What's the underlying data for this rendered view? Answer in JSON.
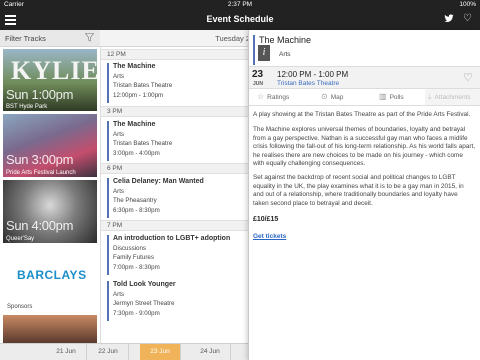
{
  "status": {
    "carrier": "Carrier",
    "time": "2:37 PM",
    "battery": "100%"
  },
  "nav": {
    "title": "Event Schedule"
  },
  "filter": {
    "label": "Filter Tracks"
  },
  "tracks": [
    {
      "headline": "KYLIE",
      "overlay": "Sun 1:00pm",
      "caption": "BST Hyde Park"
    },
    {
      "overlay": "Sun 3:00pm",
      "caption": "Pride Arts Festival Launch"
    },
    {
      "overlay": "Sun 4:00pm",
      "caption": "Queer'Say"
    },
    {
      "logo": "BARCLAYS",
      "caption": "Sponsors"
    },
    {
      "caption": ""
    }
  ],
  "schedule": {
    "day_header": "Tuesday 2",
    "hours": [
      "12 PM",
      "3 PM",
      "6 PM",
      "7 PM"
    ],
    "events": [
      {
        "title": "The Machine",
        "track": "Arts",
        "venue": "Tristan Bates Theatre",
        "time": "12:00pm - 1:00pm"
      },
      {
        "title": "The Machine",
        "track": "Arts",
        "venue": "Tristan Bates Theatre",
        "time": "3:00pm - 4:00pm"
      },
      {
        "title": "Celia Delaney: Man Wanted",
        "track": "Arts",
        "venue": "The Pheasantry",
        "time": "6:30pm - 8:30pm"
      },
      {
        "title": "An introduction to LGBT+ adoption",
        "track": "Discussions",
        "venue": "Family Futures",
        "time": "7:00pm - 8:30pm"
      },
      {
        "title": "Told Look Younger",
        "track": "Arts",
        "venue": "Jermyn Street Theatre",
        "time": "7:30pm - 9:00pm"
      }
    ]
  },
  "dates": [
    "21 Jun",
    "22 Jun",
    "23 Jun",
    "24 Jun"
  ],
  "selected_date": "23 Jun",
  "detail": {
    "title": "The Machine",
    "info_glyph": "i",
    "track": "Arts",
    "day": "23",
    "month": "JUN",
    "time": "12:00 PM - 1:00 PM",
    "venue": "Tristan Bates Theatre",
    "tabs": [
      "Ratings",
      "Map",
      "Polls",
      "Attachments"
    ],
    "p1": "A play showing at the Tristan Bates Theatre as part of the Pride Arts Festival.",
    "p2": "The Machine explores universal themes of boundaries, loyalty and betrayal from a gay perspective. Nathan is a successful gay man who faces a midlife crisis following the fall-out of his long-term relationship. As his world falls apart, he realises there are new choices to be made on his journey - which come with equally challenging consequences.",
    "p3": "Set against the backdrop of recent social and political changes to LGBT equality in the UK, the play examines what it is to be a gay man in 2015, in and out of a relationship, where traditionally boundaries and loyalty have taken second place to betrayal and deceit.",
    "price": "£10/£15",
    "link": "Get tickets"
  },
  "colors": {
    "accent": "#5572b4",
    "selected_date": "#f0b35a",
    "link": "#2a67c4"
  }
}
